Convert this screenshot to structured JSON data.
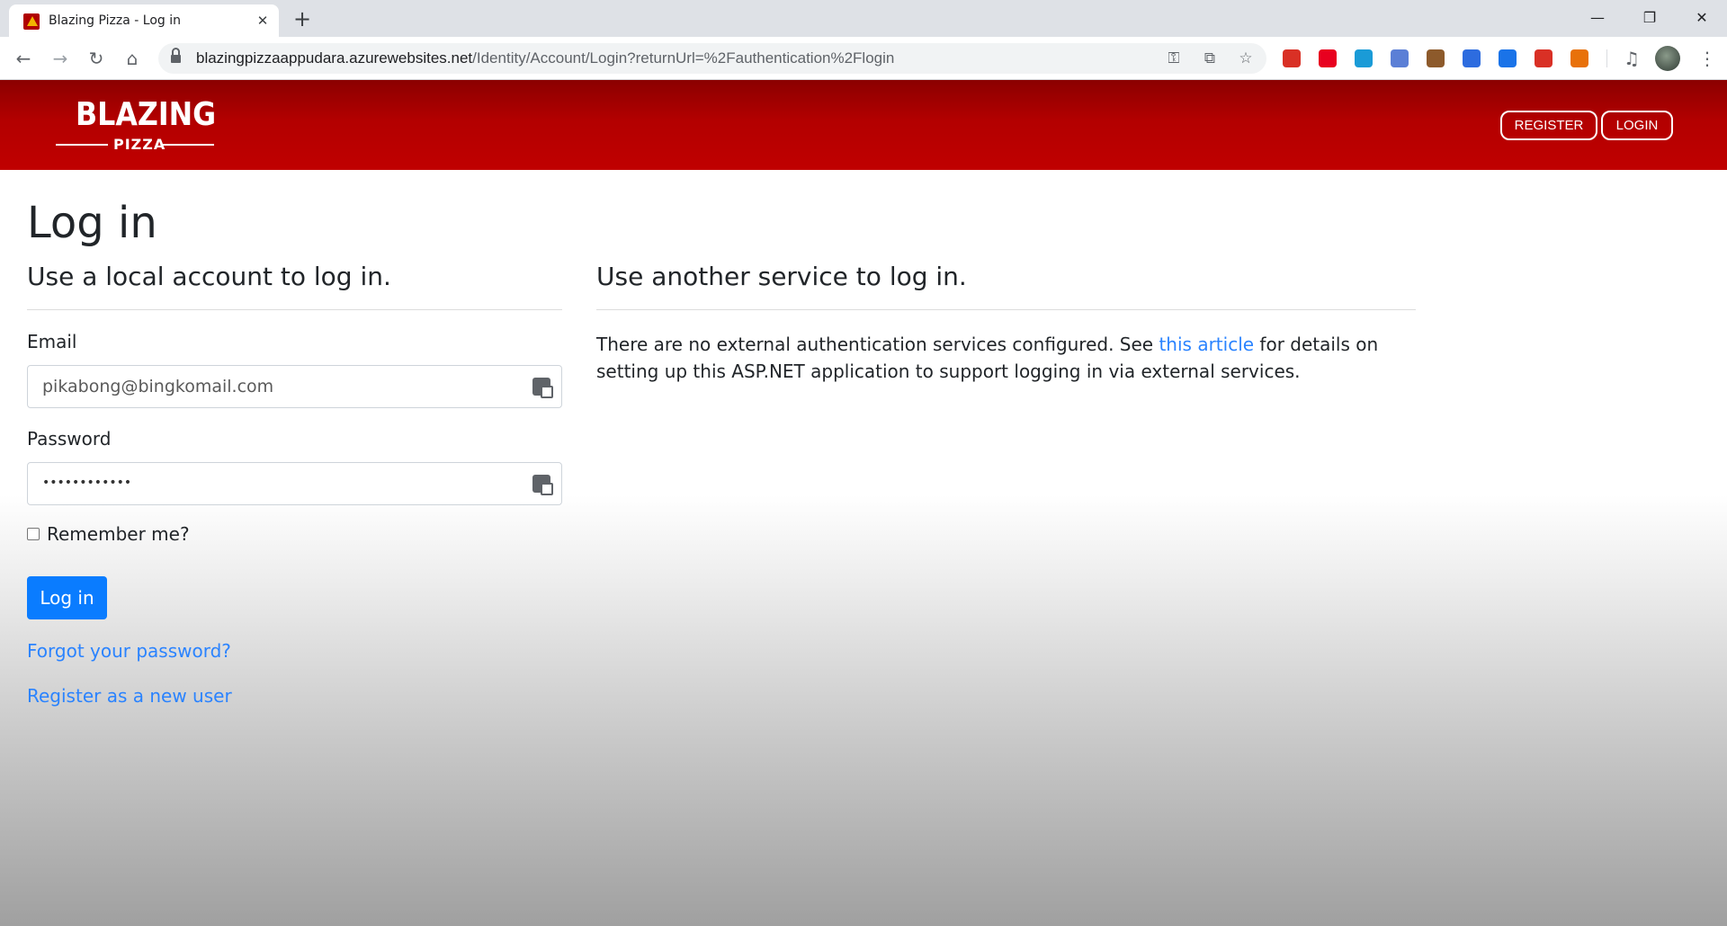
{
  "browser": {
    "tab_title": "Blazing Pizza - Log in",
    "url_host": "blazingpizzaappudara.azurewebsites.net",
    "url_path": "/Identity/Account/Login?returnUrl=%2Fauthentication%2Flogin"
  },
  "extensions": [
    {
      "name": "bookmark-ext-icon",
      "color": "#d93025"
    },
    {
      "name": "opera-ext-icon",
      "color": "#e8001f"
    },
    {
      "name": "checkbox-ext-icon",
      "color": "#1a9bd7"
    },
    {
      "name": "camera-ext-icon",
      "color": "#5b7fd6"
    },
    {
      "name": "cookie-ext-icon",
      "color": "#8d5a2b"
    },
    {
      "name": "color-ext-icon",
      "color": "#2d6cdf"
    },
    {
      "name": "download-ext-icon",
      "color": "#1a73e8"
    },
    {
      "name": "message-ext-icon",
      "color": "#d93025"
    },
    {
      "name": "network-ext-icon",
      "color": "#e8710a"
    }
  ],
  "header": {
    "logo_main": "BLAZING",
    "logo_sub": "PIZZA",
    "register_label": "REGISTER",
    "login_label": "LOGIN",
    "brand_color": "#c00000"
  },
  "page": {
    "title": "Log in",
    "local_heading": "Use a local account to log in.",
    "external_heading": "Use another service to log in.",
    "email_label": "Email",
    "email_value": "pikabong@bingkomail.com",
    "password_label": "Password",
    "password_value": "••••••••••••",
    "remember_label": "Remember me?",
    "submit_label": "Log in",
    "forgot_link": "Forgot your password?",
    "register_link": "Register as a new user",
    "external_text_before": "There are no external authentication services configured. See ",
    "external_link": "this article",
    "external_text_after": " for details on setting up this ASP.NET application to support logging in via external services.",
    "accent_color": "#0a7cff"
  }
}
